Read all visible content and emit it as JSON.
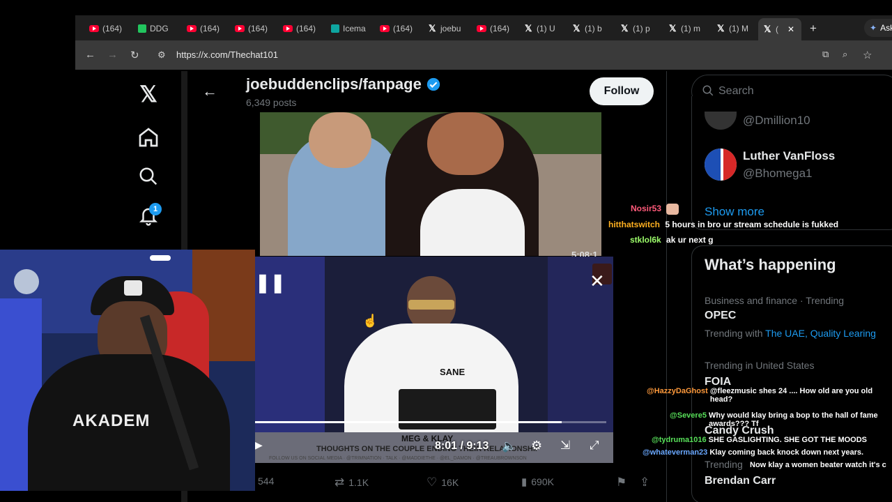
{
  "browser": {
    "tabs": [
      {
        "label": "(164)",
        "icon": "youtube-icon"
      },
      {
        "label": "DDG",
        "icon": "ddg-icon"
      },
      {
        "label": "(164)",
        "icon": "youtube-icon"
      },
      {
        "label": "(164)",
        "icon": "youtube-icon"
      },
      {
        "label": "(164)",
        "icon": "youtube-icon"
      },
      {
        "label": "Icema",
        "icon": "app-icon"
      },
      {
        "label": "(164)",
        "icon": "youtube-icon"
      },
      {
        "label": "joebu",
        "icon": "x-icon"
      },
      {
        "label": "(164)",
        "icon": "youtube-icon"
      },
      {
        "label": "(1) U",
        "icon": "x-icon"
      },
      {
        "label": "(1) b",
        "icon": "x-icon"
      },
      {
        "label": "(1) p",
        "icon": "x-icon"
      },
      {
        "label": "(1) m",
        "icon": "x-icon"
      },
      {
        "label": "(1) M",
        "icon": "x-icon"
      },
      {
        "label": "(",
        "icon": "x-icon"
      }
    ],
    "new_tab": "+",
    "ask_label": "Ask",
    "url": "https://x.com/Thechat101"
  },
  "profile": {
    "name": "joebuddenclips/fanpage",
    "posts": "6,349 posts",
    "follow_label": "Follow",
    "verified_color": "#1d9bf0"
  },
  "leftnav": {
    "notifications_badge": "1"
  },
  "search": {
    "placeholder": "Search"
  },
  "who_to_follow": {
    "users": [
      {
        "name": "",
        "handle": "@Dmillion10"
      },
      {
        "name": "Luther VanFloss",
        "handle": "@Bhomega1"
      }
    ],
    "show_more": "Show more"
  },
  "whats_happening": {
    "title": "What’s happening",
    "trends": [
      {
        "context": "Business and finance · Trending",
        "name": "OPEC",
        "with_label": "Trending with",
        "with_links": "The UAE, Quality Learing"
      },
      {
        "context": "Trending in United States",
        "name": "FOIA"
      },
      {
        "context": "",
        "name": "Candy Crush"
      },
      {
        "context": "Trending",
        "name": "Brendan Carr"
      }
    ]
  },
  "video": {
    "top_timestamp": "5:08:1",
    "time": "8:01 / 9:13",
    "progress": 0.873,
    "shirt_text": "SANE",
    "banner_title": "MEG & KLAY",
    "banner_sub": "THOUGHTS ON THE COUPLE ENDING THEIR RELATIONSHIP",
    "banner_footer": "FOLLOW US ON SOCIAL MEDIA · @TRIMNATION · TALK · @MADDIETHE · @EL_DAMON · @TREAUBROWNSON"
  },
  "post_actions": {
    "replies": "544",
    "reposts": "1.1K",
    "likes": "16K",
    "views": "690K"
  },
  "stream_chat": [
    {
      "user": "Nosir53",
      "user_color": "#ff5a7a",
      "message": ""
    },
    {
      "user": "hitthatswitch",
      "user_color": "#ffb020",
      "message": "5 hours in bro ur stream schedule is fukked"
    },
    {
      "user": "stklol6k",
      "user_color": "#9dff6b",
      "message": "ak ur next g"
    }
  ],
  "overlay_chat": [
    {
      "user": "@HazzyDaGhost",
      "user_color": "#ff9a3c",
      "message": "@fleezmusic shes 24 .... How old are you old head?"
    },
    {
      "user": "@Severe5",
      "user_color": "#58e05a",
      "message": "Why would klay bring a bop to the hall of fame awards??? Tf"
    },
    {
      "user": "@tydruma1016",
      "user_color": "#58e05a",
      "message": "SHE GASLIGHTING. SHE GOT THE MOODS"
    },
    {
      "user": "@whateverman23",
      "user_color": "#6aa8ff",
      "message": "Klay coming back knock down next years."
    },
    {
      "user": "",
      "user_color": "#ffffff",
      "message": "Now klay a women beater watch it's c"
    }
  ]
}
